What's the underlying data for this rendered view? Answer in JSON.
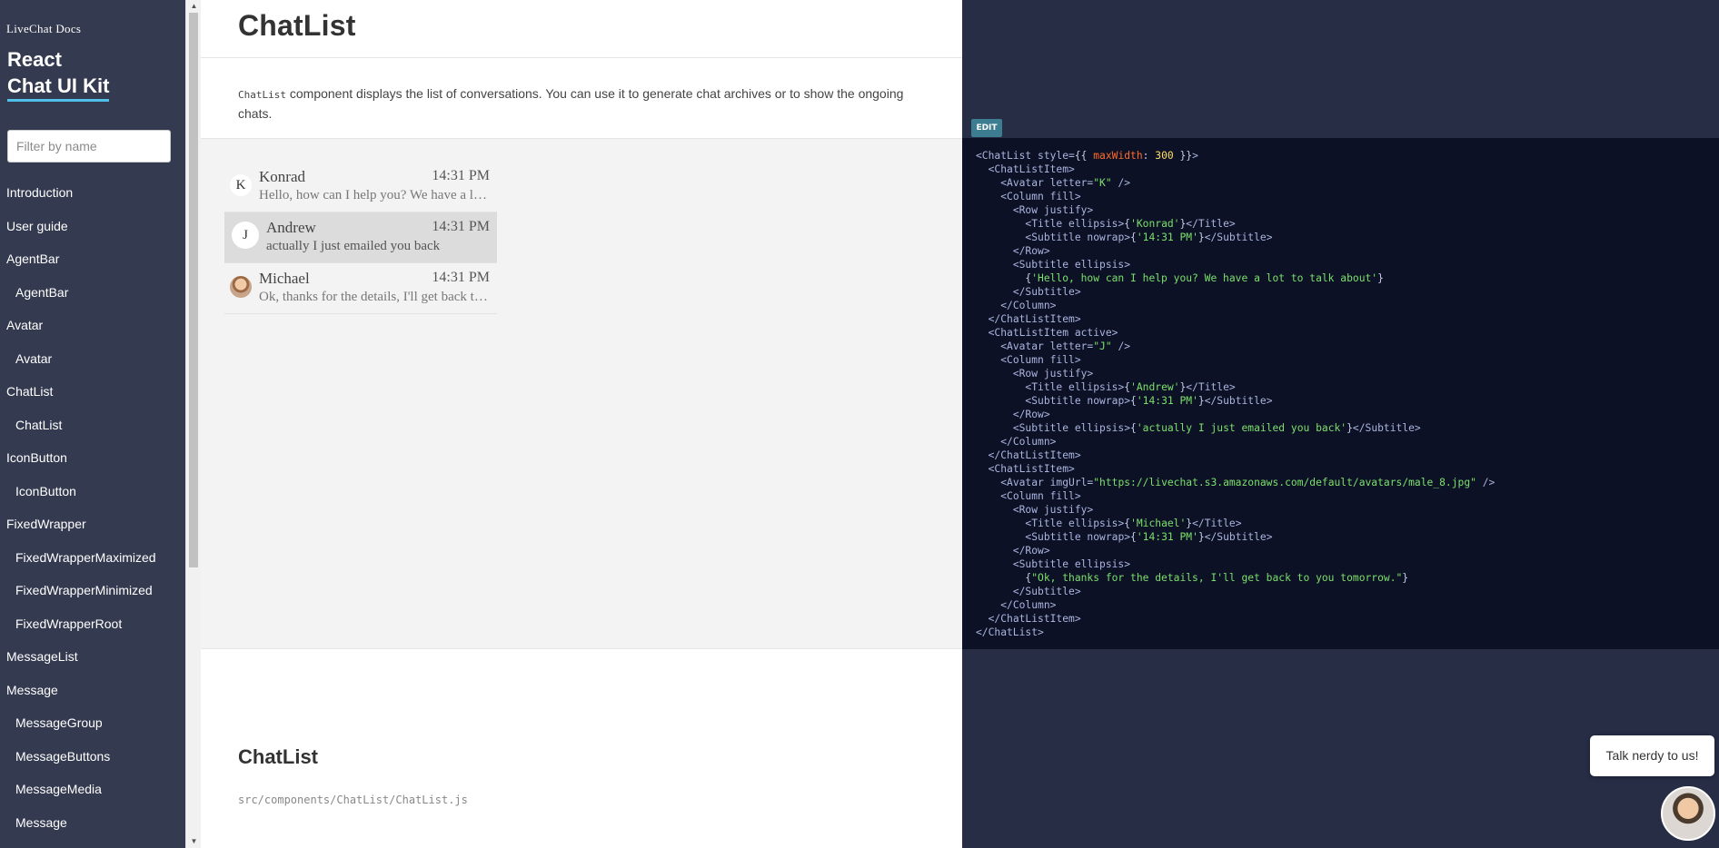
{
  "sidebar": {
    "brand_small": "LiveChat Docs",
    "brand_line1": "React",
    "brand_line2": "Chat UI Kit",
    "filter_placeholder": "Filter by name",
    "items": [
      {
        "label": "Introduction",
        "sub": false
      },
      {
        "label": "User guide",
        "sub": false
      },
      {
        "label": "AgentBar",
        "sub": false
      },
      {
        "label": "AgentBar",
        "sub": true
      },
      {
        "label": "Avatar",
        "sub": false
      },
      {
        "label": "Avatar",
        "sub": true
      },
      {
        "label": "ChatList",
        "sub": false
      },
      {
        "label": "ChatList",
        "sub": true
      },
      {
        "label": "IconButton",
        "sub": false
      },
      {
        "label": "IconButton",
        "sub": true
      },
      {
        "label": "FixedWrapper",
        "sub": false
      },
      {
        "label": "FixedWrapperMaximized",
        "sub": true
      },
      {
        "label": "FixedWrapperMinimized",
        "sub": true
      },
      {
        "label": "FixedWrapperRoot",
        "sub": true
      },
      {
        "label": "MessageList",
        "sub": false
      },
      {
        "label": "Message",
        "sub": false
      },
      {
        "label": "MessageGroup",
        "sub": true
      },
      {
        "label": "MessageButtons",
        "sub": true
      },
      {
        "label": "MessageMedia",
        "sub": true
      },
      {
        "label": "Message",
        "sub": true
      }
    ]
  },
  "main": {
    "title": "ChatList",
    "desc_code": "ChatList",
    "desc_text": " component displays the list of conversations. You can use it to generate chat archives or to show the ongoing chats.",
    "chats": [
      {
        "letter": "K",
        "title": "Konrad",
        "time": "14:31 PM",
        "subtitle": "Hello, how can I help you? We have a lot to talk about",
        "active": false,
        "img": false
      },
      {
        "letter": "J",
        "title": "Andrew",
        "time": "14:31 PM",
        "subtitle": "actually I just emailed you back",
        "active": true,
        "img": false
      },
      {
        "letter": "",
        "title": "Michael",
        "time": "14:31 PM",
        "subtitle": "Ok, thanks for the details, I'll get back to you tomorrow.",
        "active": false,
        "img": true
      }
    ],
    "section_title": "ChatList",
    "section_path": "src/components/ChatList/ChatList.js"
  },
  "editor": {
    "edit_label": "EDIT",
    "code_lines": [
      [
        [
          "t",
          "<ChatList style="
        ],
        [
          "p",
          "{{ "
        ],
        [
          "k",
          "maxWidth"
        ],
        [
          "p",
          ": "
        ],
        [
          "n",
          "300"
        ],
        [
          "p",
          " }}"
        ],
        [
          "t",
          ">"
        ]
      ],
      [
        [
          "p",
          "  "
        ],
        [
          "t",
          "<ChatListItem>"
        ]
      ],
      [
        [
          "p",
          "    "
        ],
        [
          "t",
          "<Avatar letter="
        ],
        [
          "s",
          "\"K\""
        ],
        [
          "t",
          " />"
        ]
      ],
      [
        [
          "p",
          "    "
        ],
        [
          "t",
          "<Column fill>"
        ]
      ],
      [
        [
          "p",
          "      "
        ],
        [
          "t",
          "<Row justify>"
        ]
      ],
      [
        [
          "p",
          "        "
        ],
        [
          "t",
          "<Title ellipsis>"
        ],
        [
          "p",
          "{"
        ],
        [
          "s",
          "'Konrad'"
        ],
        [
          "p",
          "}"
        ],
        [
          "t",
          "</Title>"
        ]
      ],
      [
        [
          "p",
          "        "
        ],
        [
          "t",
          "<Subtitle nowrap>"
        ],
        [
          "p",
          "{"
        ],
        [
          "s",
          "'14:31 PM'"
        ],
        [
          "p",
          "}"
        ],
        [
          "t",
          "</Subtitle>"
        ]
      ],
      [
        [
          "p",
          "      "
        ],
        [
          "t",
          "</Row>"
        ]
      ],
      [
        [
          "p",
          "      "
        ],
        [
          "t",
          "<Subtitle ellipsis>"
        ]
      ],
      [
        [
          "p",
          "        {"
        ],
        [
          "s",
          "'Hello, how can I help you? We have a lot to talk about'"
        ],
        [
          "p",
          "}"
        ]
      ],
      [
        [
          "p",
          "      "
        ],
        [
          "t",
          "</Subtitle>"
        ]
      ],
      [
        [
          "p",
          "    "
        ],
        [
          "t",
          "</Column>"
        ]
      ],
      [
        [
          "p",
          "  "
        ],
        [
          "t",
          "</ChatListItem>"
        ]
      ],
      [
        [
          "p",
          "  "
        ],
        [
          "t",
          "<ChatListItem active>"
        ]
      ],
      [
        [
          "p",
          "    "
        ],
        [
          "t",
          "<Avatar letter="
        ],
        [
          "s",
          "\"J\""
        ],
        [
          "t",
          " />"
        ]
      ],
      [
        [
          "p",
          "    "
        ],
        [
          "t",
          "<Column fill>"
        ]
      ],
      [
        [
          "p",
          "      "
        ],
        [
          "t",
          "<Row justify>"
        ]
      ],
      [
        [
          "p",
          "        "
        ],
        [
          "t",
          "<Title ellipsis>"
        ],
        [
          "p",
          "{"
        ],
        [
          "s",
          "'Andrew'"
        ],
        [
          "p",
          "}"
        ],
        [
          "t",
          "</Title>"
        ]
      ],
      [
        [
          "p",
          "        "
        ],
        [
          "t",
          "<Subtitle nowrap>"
        ],
        [
          "p",
          "{"
        ],
        [
          "s",
          "'14:31 PM'"
        ],
        [
          "p",
          "}"
        ],
        [
          "t",
          "</Subtitle>"
        ]
      ],
      [
        [
          "p",
          "      "
        ],
        [
          "t",
          "</Row>"
        ]
      ],
      [
        [
          "p",
          "      "
        ],
        [
          "t",
          "<Subtitle ellipsis>"
        ],
        [
          "p",
          "{"
        ],
        [
          "s",
          "'actually I just emailed you back'"
        ],
        [
          "p",
          "}"
        ],
        [
          "t",
          "</Subtitle>"
        ]
      ],
      [
        [
          "p",
          "    "
        ],
        [
          "t",
          "</Column>"
        ]
      ],
      [
        [
          "p",
          "  "
        ],
        [
          "t",
          "</ChatListItem>"
        ]
      ],
      [
        [
          "p",
          "  "
        ],
        [
          "t",
          "<ChatListItem>"
        ]
      ],
      [
        [
          "p",
          "    "
        ],
        [
          "t",
          "<Avatar imgUrl="
        ],
        [
          "s",
          "\"https://livechat.s3.amazonaws.com/default/avatars/male_8.jpg\""
        ],
        [
          "t",
          " />"
        ]
      ],
      [
        [
          "p",
          "    "
        ],
        [
          "t",
          "<Column fill>"
        ]
      ],
      [
        [
          "p",
          "      "
        ],
        [
          "t",
          "<Row justify>"
        ]
      ],
      [
        [
          "p",
          "        "
        ],
        [
          "t",
          "<Title ellipsis>"
        ],
        [
          "p",
          "{"
        ],
        [
          "s",
          "'Michael'"
        ],
        [
          "p",
          "}"
        ],
        [
          "t",
          "</Title>"
        ]
      ],
      [
        [
          "p",
          "        "
        ],
        [
          "t",
          "<Subtitle nowrap>"
        ],
        [
          "p",
          "{"
        ],
        [
          "s",
          "'14:31 PM'"
        ],
        [
          "p",
          "}"
        ],
        [
          "t",
          "</Subtitle>"
        ]
      ],
      [
        [
          "p",
          "      "
        ],
        [
          "t",
          "</Row>"
        ]
      ],
      [
        [
          "p",
          "      "
        ],
        [
          "t",
          "<Subtitle ellipsis>"
        ]
      ],
      [
        [
          "p",
          "        {"
        ],
        [
          "s",
          "\"Ok, thanks for the details, I'll get back to you tomorrow.\""
        ],
        [
          "p",
          "}"
        ]
      ],
      [
        [
          "p",
          "      "
        ],
        [
          "t",
          "</Subtitle>"
        ]
      ],
      [
        [
          "p",
          "    "
        ],
        [
          "t",
          "</Column>"
        ]
      ],
      [
        [
          "p",
          "  "
        ],
        [
          "t",
          "</ChatListItem>"
        ]
      ],
      [
        [
          "t",
          "</ChatList>"
        ]
      ]
    ]
  },
  "widget": {
    "bubble_text": "Talk nerdy to us!"
  },
  "colors": {
    "sidebar_bg": "#343a4f",
    "editor_bg": "#0d1125",
    "panel_bg": "#262d45",
    "accent": "#4fc1e9",
    "edit_badge": "#3d7d92"
  }
}
